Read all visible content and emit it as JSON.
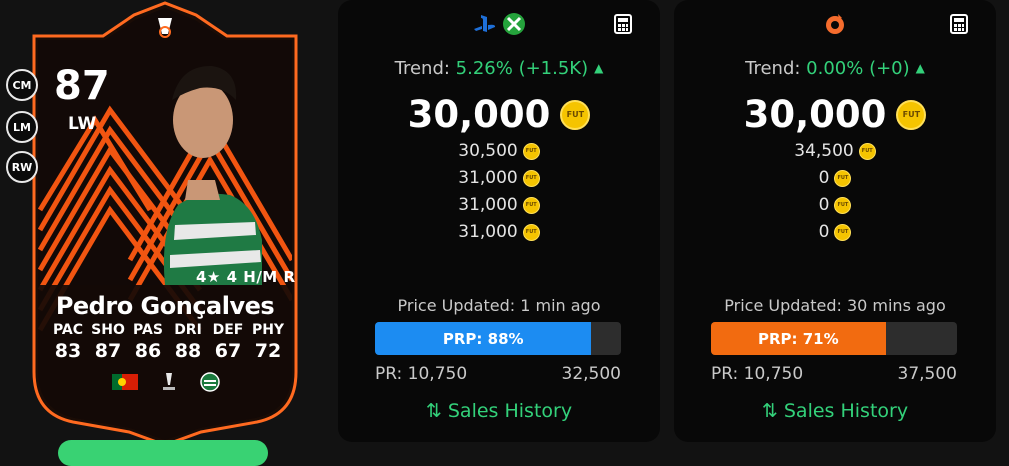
{
  "card": {
    "rating": "87",
    "position": "LW",
    "alt_positions": [
      "CM",
      "LM",
      "RW"
    ],
    "skills": "4★ 4 H/M R",
    "name": "Pedro Gonçalves",
    "stats": [
      {
        "label": "PAC",
        "value": "83"
      },
      {
        "label": "SHO",
        "value": "87"
      },
      {
        "label": "PAS",
        "value": "86"
      },
      {
        "label": "DRI",
        "value": "88"
      },
      {
        "label": "DEF",
        "value": "67"
      },
      {
        "label": "PHY",
        "value": "72"
      }
    ],
    "icons": [
      "europa-league-icon",
      "portugal-flag-icon",
      "liga-portugal-icon",
      "sporting-club-icon"
    ],
    "accent": "#ff5a12"
  },
  "panels": [
    {
      "platforms": [
        "playstation-icon",
        "xbox-icon"
      ],
      "trend_label": "Trend:",
      "trend_value": "5.26% (+1.5K)",
      "main_price": "30,000",
      "alt_prices": [
        "30,500",
        "31,000",
        "31,000",
        "31,000"
      ],
      "updated": "Price Updated: 1 min ago",
      "prp_label": "PRP: 88%",
      "prp_percent": 88,
      "bar_color": "#1c8cf2",
      "pr_min": "PR: 10,750",
      "pr_max": "32,500",
      "history": "Sales History"
    },
    {
      "platforms": [
        "origin-icon"
      ],
      "trend_label": "Trend:",
      "trend_value": "0.00% (+0)",
      "main_price": "30,000",
      "alt_prices": [
        "34,500",
        "0",
        "0",
        "0"
      ],
      "updated": "Price Updated: 30 mins ago",
      "prp_label": "PRP: 71%",
      "prp_percent": 71,
      "bar_color": "#f26b10",
      "pr_min": "PR: 10,750",
      "pr_max": "37,500",
      "history": "Sales History"
    }
  ],
  "coin_text": "FUT",
  "colors": {
    "green": "#33d17a",
    "coin": "#f5c400"
  }
}
